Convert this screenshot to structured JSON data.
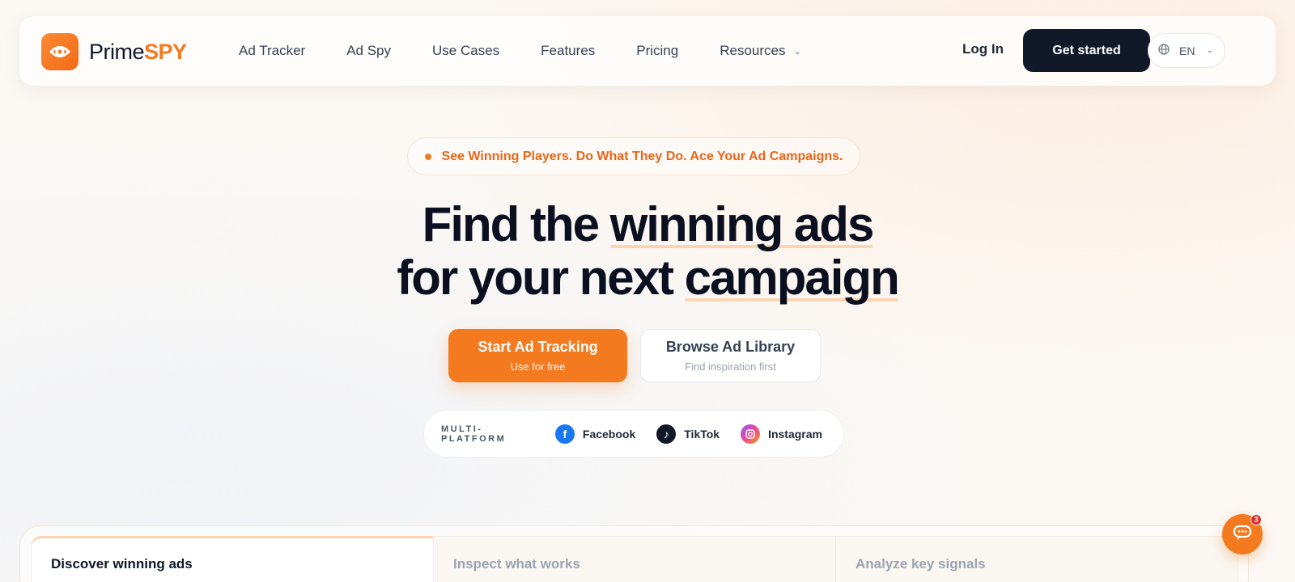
{
  "brand": {
    "name_prefix": "Prime",
    "name_suffix": "SPY",
    "accent": "#f47a1f",
    "logo_icon": "eye-logo-icon"
  },
  "nav": {
    "links": [
      "Ad Tracker",
      "Ad Spy",
      "Use Cases",
      "Features",
      "Pricing",
      "Resources"
    ],
    "login_label": "Log In",
    "cta_label": "Get started",
    "language": "EN"
  },
  "hero": {
    "tagline": "See Winning Players. Do What They Do. Ace Your Ad Campaigns.",
    "headline": {
      "line1_plain": "Find the",
      "line1_highlight": "winning ads",
      "line2_plain": "for your next",
      "line2_highlight": "campaign"
    },
    "primary_button": {
      "label": "Start Ad Tracking",
      "sublabel": "Use for free"
    },
    "secondary_button": {
      "label": "Browse Ad Library",
      "sublabel": "Find inspiration first"
    }
  },
  "platforms": {
    "label": "MULTI-PLATFORM",
    "items": [
      {
        "name": "Facebook",
        "icon": "facebook-icon",
        "color": "#1877f2"
      },
      {
        "name": "TikTok",
        "icon": "tiktok-icon",
        "color": "#111827"
      },
      {
        "name": "Instagram",
        "icon": "instagram-icon",
        "color": "#d946ef"
      }
    ]
  },
  "feature_tabs": {
    "tabs": [
      "Discover winning ads",
      "Inspect what works",
      "Analyze key signals"
    ],
    "active_index": 0
  },
  "chat": {
    "badge_count": "3"
  }
}
